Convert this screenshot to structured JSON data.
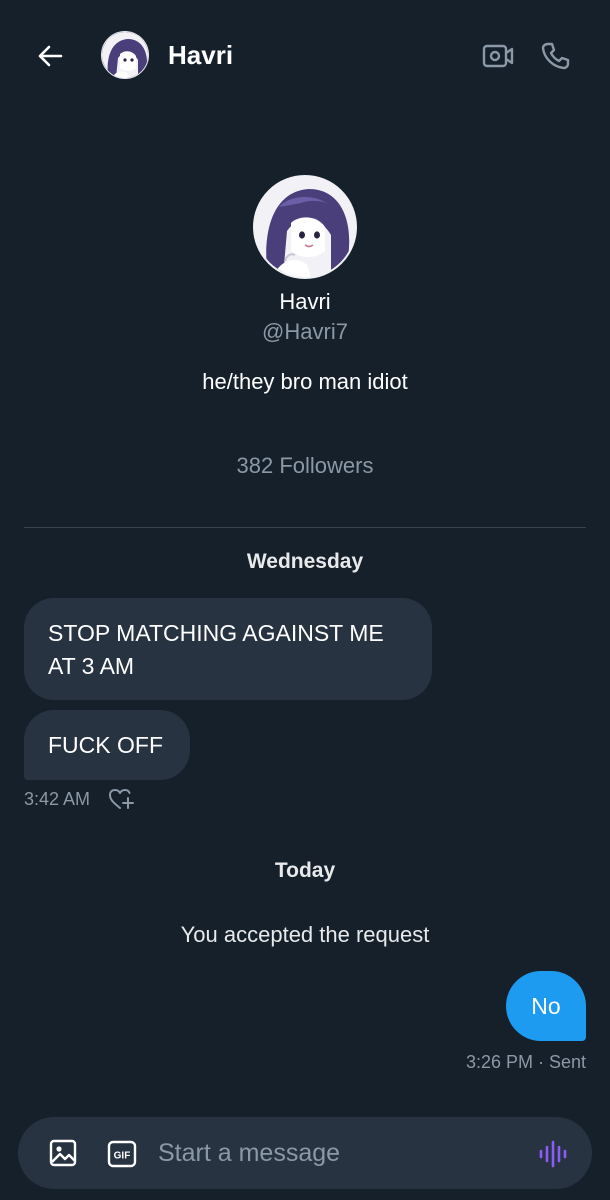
{
  "header": {
    "contact_name": "Havri",
    "icons": [
      "arrow-left-icon",
      "video-camera-icon",
      "phone-icon"
    ]
  },
  "profile": {
    "name": "Havri",
    "handle": "@Havri7",
    "bio": "he/they bro man idiot",
    "followers": "382 Followers"
  },
  "conversation": {
    "groups": [
      {
        "day": "Wednesday",
        "messages": [
          {
            "direction": "incoming",
            "text": "STOP MATCHING AGAINST ME AT 3 AM"
          },
          {
            "direction": "incoming",
            "text": "FUCK OFF"
          }
        ],
        "time": "3:42 AM"
      },
      {
        "day": "Today",
        "system_message": "You accepted the request",
        "messages": [
          {
            "direction": "outgoing",
            "text": "No"
          }
        ],
        "time_status": "3:26 PM · Sent"
      }
    ]
  },
  "composer": {
    "placeholder": "Start a message",
    "gif_label": "GIF",
    "icons": [
      "image-icon",
      "gif-icon",
      "voice-icon"
    ]
  },
  "colors": {
    "background": "#15202b",
    "bubble_incoming": "#273340",
    "bubble_outgoing": "#1d9bf0",
    "muted_text": "#8b98a5",
    "voice_accent": "#8b5cf6"
  }
}
